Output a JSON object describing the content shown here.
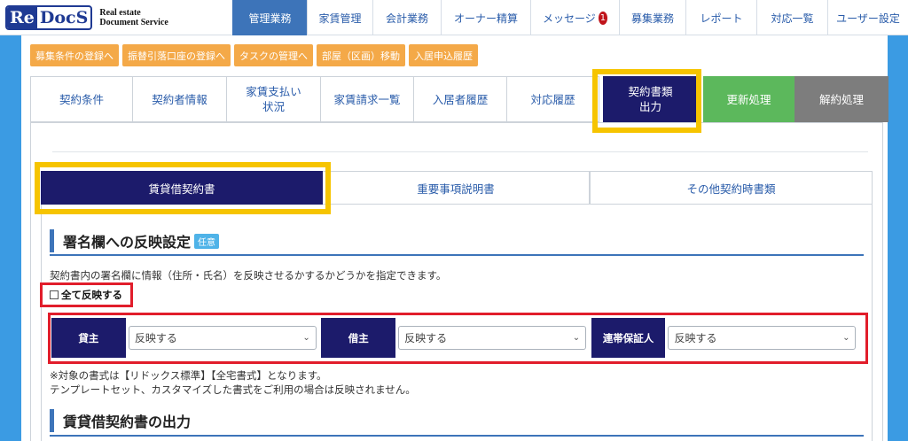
{
  "logo": {
    "re": "Re",
    "docs": "DocS",
    "sub_line1": "Real estate",
    "sub_line2": "Document Service"
  },
  "nav": [
    {
      "label": "管理業務",
      "active": true
    },
    {
      "label": "家賃管理"
    },
    {
      "label": "会計業務"
    },
    {
      "label": "オーナー精算"
    },
    {
      "label": "メッセージ",
      "badge": "1"
    },
    {
      "label": "募集業務"
    },
    {
      "label": "レポート"
    },
    {
      "label": "対応一覧"
    },
    {
      "label": "ユーザー設定"
    }
  ],
  "shortcuts": [
    "募集条件の登録へ",
    "振替引落口座の登録へ",
    "タスクの管理へ",
    "部屋（区画）移動",
    "入居申込履歴"
  ],
  "main_tabs": {
    "t1": "契約条件",
    "t2": "契約者情報",
    "t3_l1": "家賃支払い",
    "t3_l2": "状況",
    "t4": "家賃請求一覧",
    "t5": "入居者履歴",
    "t6": "対応履歴",
    "t7_l1": "契約書類",
    "t7_l2": "出力",
    "t8": "更新処理",
    "t9": "解約処理"
  },
  "sub_tabs": {
    "s1": "賃貸借契約書",
    "s2": "重要事項説明書",
    "s3": "その他契約時書類"
  },
  "section1": {
    "title": "署名欄への反映設定",
    "tag": "任意"
  },
  "description": "契約書内の署名欄に情報（住所・氏名）を反映させるかするかどうかを指定できます。",
  "checkbox_label": "全て反映する",
  "signers": [
    {
      "label": "貸主",
      "value": "反映する"
    },
    {
      "label": "借主",
      "value": "反映する"
    },
    {
      "label": "連帯保証人",
      "value": "反映する"
    }
  ],
  "note1": "※対象の書式は【リドックス標準】【全宅書式】となります。",
  "note2": "テンプレートセット、カスタマイズした書式をご利用の場合は反映されません。",
  "section2": {
    "title": "賃貸借契約書の出力"
  },
  "colors": {
    "accent": "#3d74b9",
    "navy": "#1c1b6b",
    "highlight_yellow": "#f6c400",
    "highlight_red": "#e11d2b"
  }
}
